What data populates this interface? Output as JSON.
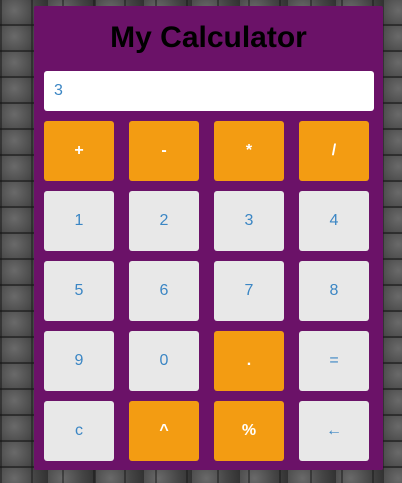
{
  "app": {
    "title": "My Calculator"
  },
  "display": {
    "value": "3"
  },
  "keys": [
    {
      "label": "+",
      "kind": "op",
      "name": "plus-button"
    },
    {
      "label": "-",
      "kind": "op",
      "name": "minus-button"
    },
    {
      "label": "*",
      "kind": "op",
      "name": "multiply-button"
    },
    {
      "label": "/",
      "kind": "op",
      "name": "divide-button"
    },
    {
      "label": "1",
      "kind": "num",
      "name": "digit-1-button"
    },
    {
      "label": "2",
      "kind": "num",
      "name": "digit-2-button"
    },
    {
      "label": "3",
      "kind": "num",
      "name": "digit-3-button"
    },
    {
      "label": "4",
      "kind": "num",
      "name": "digit-4-button"
    },
    {
      "label": "5",
      "kind": "num",
      "name": "digit-5-button"
    },
    {
      "label": "6",
      "kind": "num",
      "name": "digit-6-button"
    },
    {
      "label": "7",
      "kind": "num",
      "name": "digit-7-button"
    },
    {
      "label": "8",
      "kind": "num",
      "name": "digit-8-button"
    },
    {
      "label": "9",
      "kind": "num",
      "name": "digit-9-button"
    },
    {
      "label": "0",
      "kind": "num",
      "name": "digit-0-button"
    },
    {
      "label": ".",
      "kind": "op",
      "name": "decimal-button"
    },
    {
      "label": "=",
      "kind": "num",
      "name": "equals-button"
    },
    {
      "label": "c",
      "kind": "num",
      "name": "clear-button"
    },
    {
      "label": "^",
      "kind": "op",
      "name": "power-button"
    },
    {
      "label": "%",
      "kind": "op",
      "name": "percent-button"
    },
    {
      "label": "←",
      "kind": "num",
      "name": "backspace-button"
    }
  ],
  "colors": {
    "panel": "#6b1268",
    "operator_key": "#f39c12",
    "number_key": "#e8e8e8",
    "number_text": "#3b86c4"
  }
}
